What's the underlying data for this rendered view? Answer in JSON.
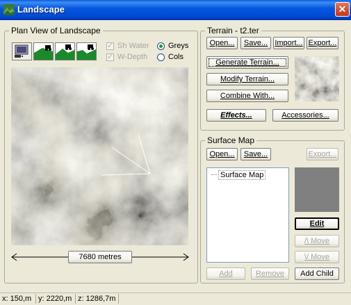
{
  "window": {
    "title": "Landscape",
    "close_glyph": "✕",
    "app_icon": "landscape-app-icon"
  },
  "plan_view": {
    "title": "Plan View of Landscape",
    "view_buttons": [
      "screen-view-icon",
      "tractor-view-icon-1",
      "tractor-view-icon-2",
      "tractor-view-icon-3"
    ],
    "sh_water_label": "Sh Water",
    "w_depth_label": "W-Depth",
    "greys_label": "Greys",
    "cols_label": "Cols",
    "colour_mode": "Greys",
    "scale_label": "7680 metres"
  },
  "terrain": {
    "title": "Terrain - t2.ter",
    "open": "Open...",
    "save": "Save...",
    "import": "Import...",
    "export": "Export...",
    "generate": "Generate Terrain...",
    "modify": "Modify Terrain...",
    "combine": "Combine With...",
    "effects": "Effects...",
    "accessories": "Accessories..."
  },
  "surface_map": {
    "title": "Surface Map",
    "open": "Open...",
    "save": "Save...",
    "export": "Export...",
    "tree_item": "Surface Map",
    "edit": "Edit",
    "up_move": "/\\ Move",
    "down_move": "\\/ Move",
    "add": "Add",
    "remove": "Remove",
    "add_child": "Add Child",
    "swatch_color": "#808080"
  },
  "status": {
    "x": "x: 150,m",
    "y": "y: 2220,m",
    "z": "z: 1286,7m"
  }
}
